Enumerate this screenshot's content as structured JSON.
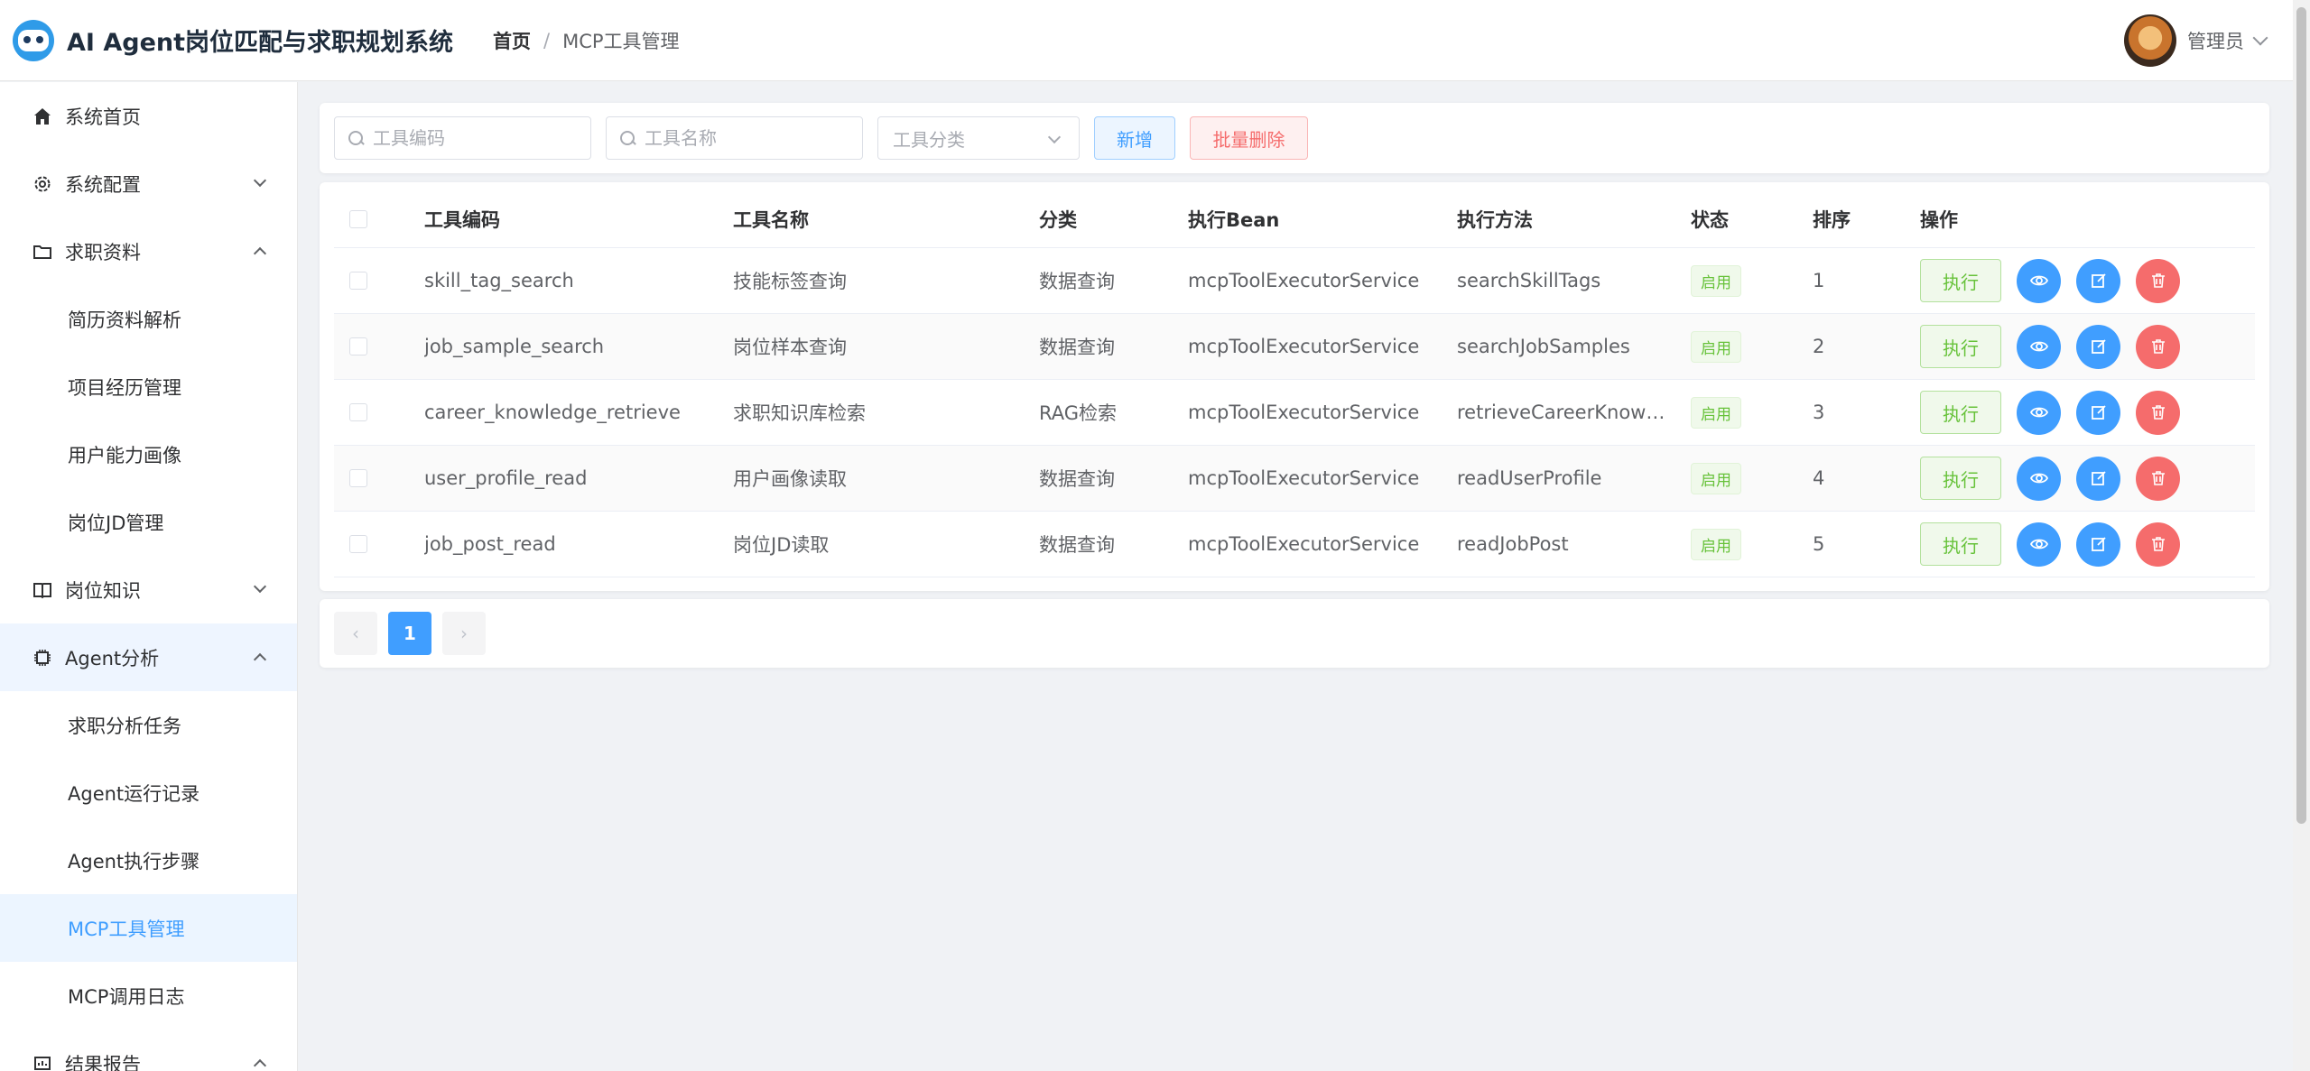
{
  "header": {
    "app_title": "AI Agent岗位匹配与求职规划系统",
    "breadcrumb": {
      "home": "首页",
      "separator": "/",
      "current": "MCP工具管理"
    },
    "user": {
      "name": "管理员"
    }
  },
  "sidebar": {
    "items": [
      {
        "label": "系统首页",
        "icon": "home-icon"
      },
      {
        "label": "系统配置",
        "icon": "gear-icon",
        "expanded": false
      },
      {
        "label": "求职资料",
        "icon": "folder-icon",
        "expanded": true,
        "children": [
          "简历资料解析",
          "项目经历管理",
          "用户能力画像",
          "岗位JD管理"
        ]
      },
      {
        "label": "岗位知识",
        "icon": "book-icon",
        "expanded": false
      },
      {
        "label": "Agent分析",
        "icon": "chip-icon",
        "expanded": true,
        "children": [
          "求职分析任务",
          "Agent运行记录",
          "Agent执行步骤",
          "MCP工具管理",
          "MCP调用日志"
        ]
      },
      {
        "label": "结果报告",
        "icon": "report-icon",
        "expanded": true
      }
    ],
    "active": "MCP工具管理"
  },
  "toolbar": {
    "code_placeholder": "工具编码",
    "name_placeholder": "工具名称",
    "category_placeholder": "工具分类",
    "add_label": "新增",
    "batch_delete_label": "批量删除"
  },
  "table": {
    "columns": [
      "工具编码",
      "工具名称",
      "分类",
      "执行Bean",
      "执行方法",
      "状态",
      "排序",
      "操作"
    ],
    "rows": [
      {
        "code": "skill_tag_search",
        "name": "技能标签查询",
        "category": "数据查询",
        "bean": "mcpToolExecutorService",
        "method": "searchSkillTags",
        "status": "启用",
        "sort": "1"
      },
      {
        "code": "job_sample_search",
        "name": "岗位样本查询",
        "category": "数据查询",
        "bean": "mcpToolExecutorService",
        "method": "searchJobSamples",
        "status": "启用",
        "sort": "2"
      },
      {
        "code": "career_knowledge_retrieve",
        "name": "求职知识库检索",
        "category": "RAG检索",
        "bean": "mcpToolExecutorService",
        "method": "retrieveCareerKnow…",
        "status": "启用",
        "sort": "3"
      },
      {
        "code": "user_profile_read",
        "name": "用户画像读取",
        "category": "数据查询",
        "bean": "mcpToolExecutorService",
        "method": "readUserProfile",
        "status": "启用",
        "sort": "4"
      },
      {
        "code": "job_post_read",
        "name": "岗位JD读取",
        "category": "数据查询",
        "bean": "mcpToolExecutorService",
        "method": "readJobPost",
        "status": "启用",
        "sort": "5"
      }
    ],
    "exec_label": "执行"
  },
  "pagination": {
    "current_page": "1",
    "prev": "‹",
    "next": "›"
  },
  "colors": {
    "primary": "#409eff",
    "success": "#67c23a",
    "danger": "#f56c6c"
  }
}
